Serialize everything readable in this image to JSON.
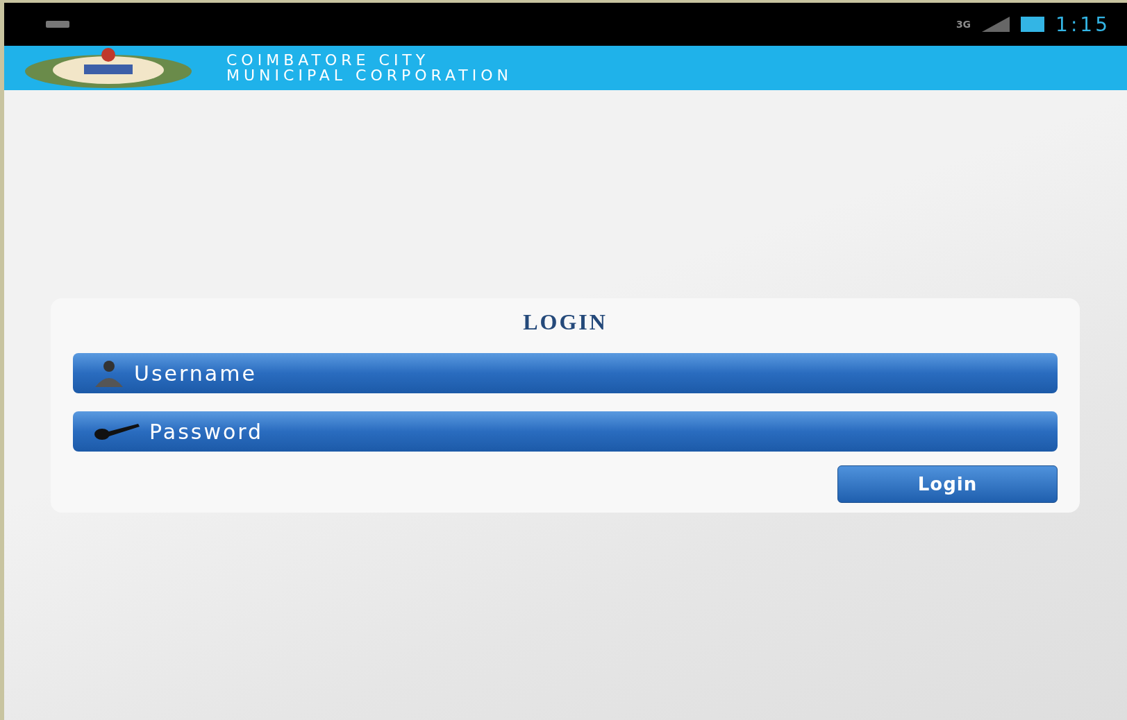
{
  "status_bar": {
    "network": "3G",
    "time": "1:15"
  },
  "header": {
    "title_lines": [
      "COIMBATORE CITY",
      "MUNICIPAL CORPORATION"
    ]
  },
  "login": {
    "title": "LOGIN",
    "username": {
      "placeholder": "Username"
    },
    "password": {
      "placeholder": "Password"
    },
    "button": "Login"
  }
}
